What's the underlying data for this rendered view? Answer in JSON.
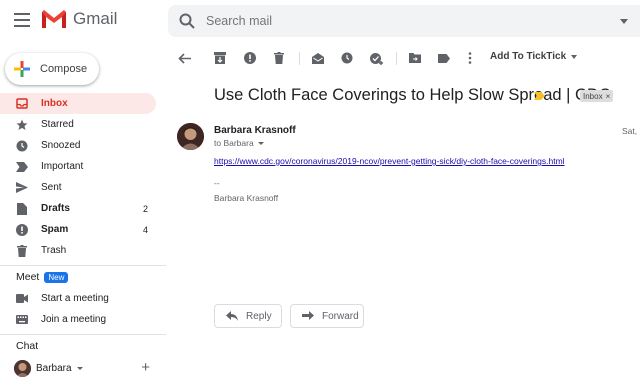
{
  "app": {
    "name": "Gmail"
  },
  "search": {
    "placeholder": "Search mail"
  },
  "compose": {
    "label": "Compose"
  },
  "nav": {
    "items": [
      {
        "label": "Inbox",
        "icon": "inbox-icon",
        "count": ""
      },
      {
        "label": "Starred",
        "icon": "star-icon",
        "count": ""
      },
      {
        "label": "Snoozed",
        "icon": "clock-icon",
        "count": ""
      },
      {
        "label": "Important",
        "icon": "important-icon",
        "count": ""
      },
      {
        "label": "Sent",
        "icon": "send-icon",
        "count": ""
      },
      {
        "label": "Drafts",
        "icon": "draft-icon",
        "count": "2"
      },
      {
        "label": "Spam",
        "icon": "spam-icon",
        "count": "4"
      },
      {
        "label": "Trash",
        "icon": "trash-icon",
        "count": ""
      }
    ]
  },
  "meet": {
    "title": "Meet",
    "badge": "New",
    "items": [
      {
        "label": "Start a meeting",
        "icon": "video-icon"
      },
      {
        "label": "Join a meeting",
        "icon": "keyboard-icon"
      }
    ]
  },
  "chat": {
    "title": "Chat",
    "user": "Barbara"
  },
  "toolbar": {
    "ticktick_label": "Add To TickTick"
  },
  "email": {
    "subject": "Use Cloth Face Coverings to Help Slow Spread | CDC",
    "label": "Inbox",
    "sender": "Barbara Krasnoff",
    "to": "to Barbara",
    "date": "Sat, M",
    "link": "https://www.cdc.gov/coronavirus/2019-ncov/prevent-getting-sick/diy-cloth-face-coverings.html",
    "sig_dash": "--",
    "sig_name": "Barbara Krasnoff"
  },
  "actions": {
    "reply": "Reply",
    "forward": "Forward"
  },
  "colors": {
    "accent_red": "#d93025",
    "active_bg": "#fce8e6",
    "link": "#1a0dab",
    "badge_blue": "#1a73e8"
  }
}
